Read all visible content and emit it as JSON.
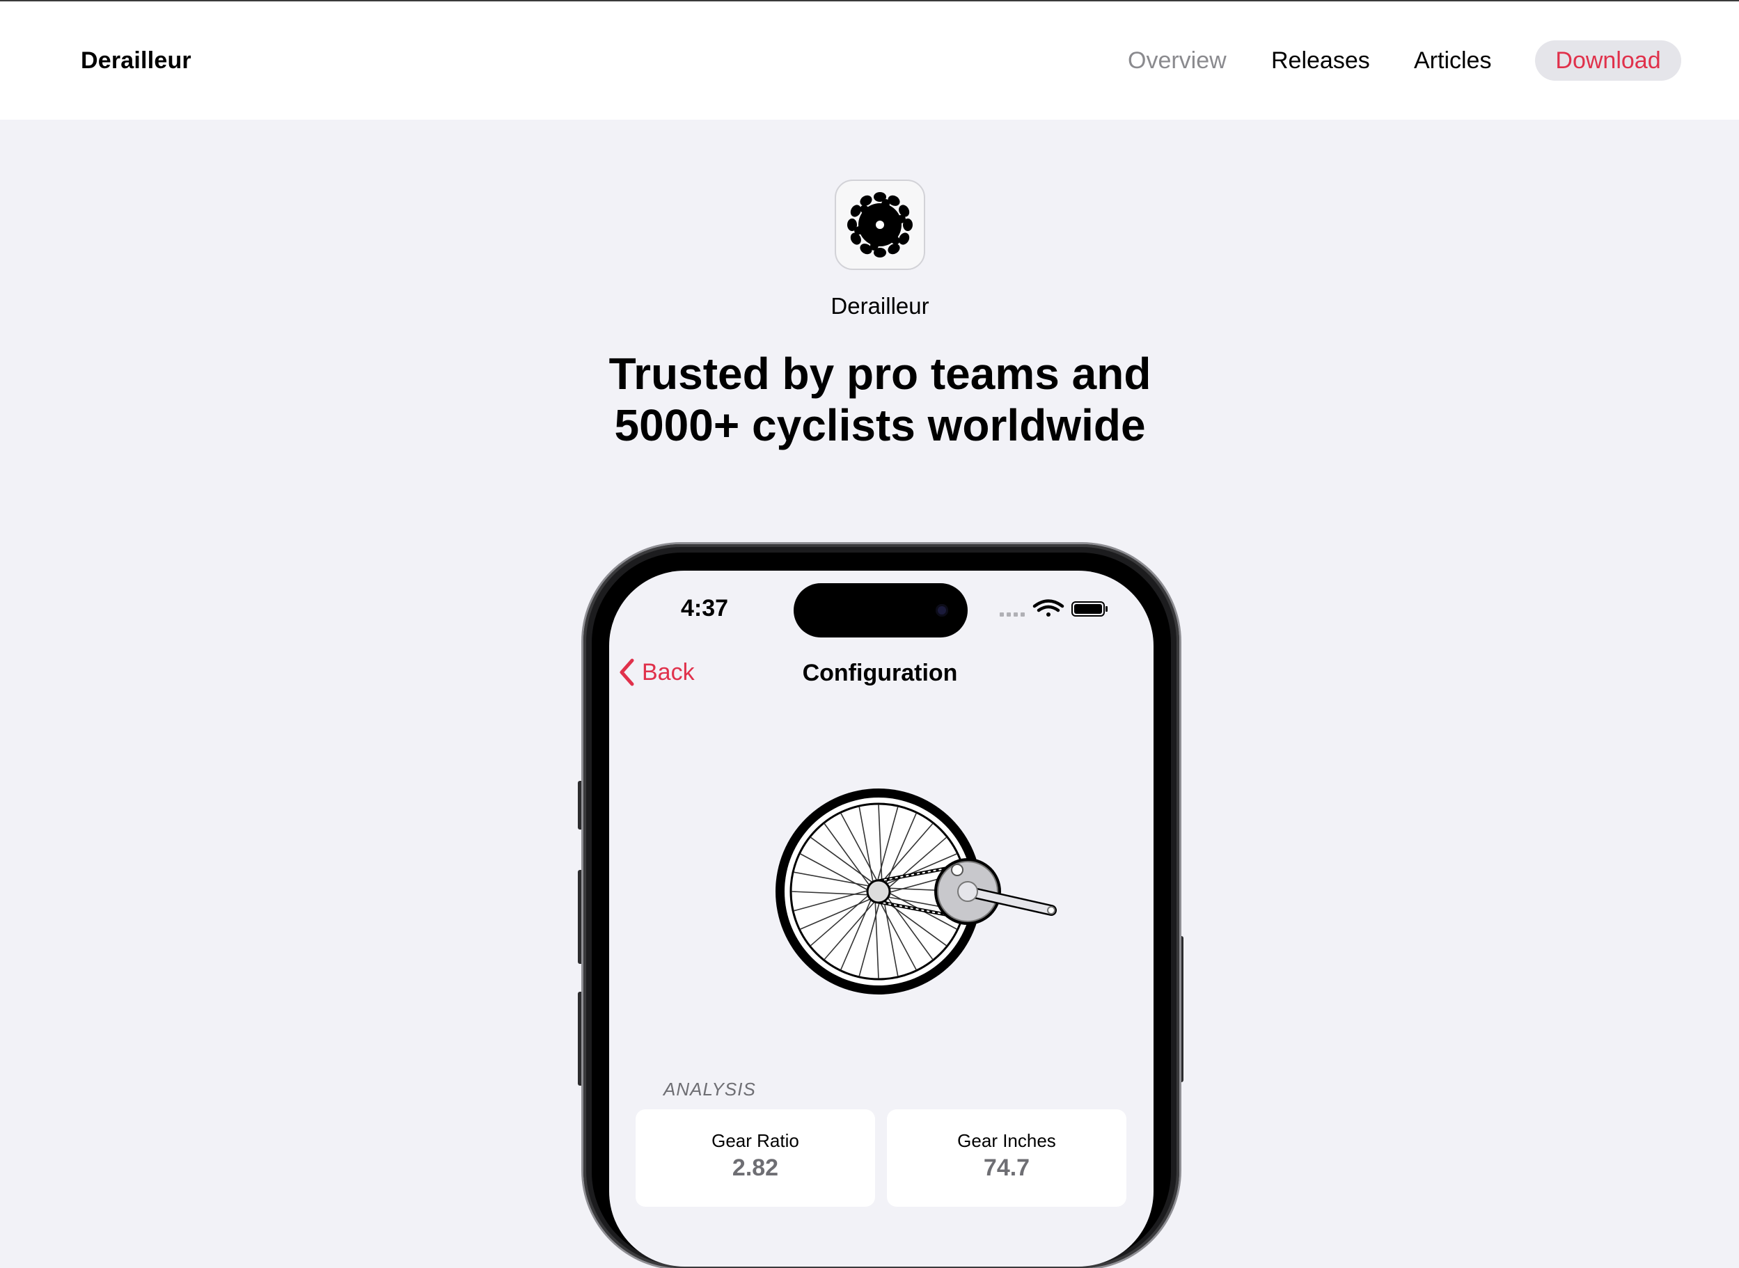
{
  "nav": {
    "brand": "Derailleur",
    "links": [
      {
        "label": "Overview",
        "active": true
      },
      {
        "label": "Releases",
        "active": false
      },
      {
        "label": "Articles",
        "active": false
      }
    ],
    "download_label": "Download"
  },
  "hero": {
    "app_name": "Derailleur",
    "headline": "Trusted by pro teams and 5000+ cyclists worldwide"
  },
  "phone": {
    "time": "4:37",
    "back_label": "Back",
    "title": "Configuration",
    "section_label": "ANALYSIS",
    "cards": [
      {
        "label": "Gear Ratio",
        "value": "2.82"
      },
      {
        "label": "Gear Inches",
        "value": "74.7"
      }
    ]
  },
  "colors": {
    "accent": "#e0314b",
    "page_background": "#f2f2f7",
    "muted_text": "#8a8a8e"
  },
  "icons": {
    "app": "chainring-icon",
    "back": "chevron-left-icon",
    "signal": "cellular-signal-icon",
    "wifi": "wifi-icon",
    "battery": "battery-icon"
  }
}
